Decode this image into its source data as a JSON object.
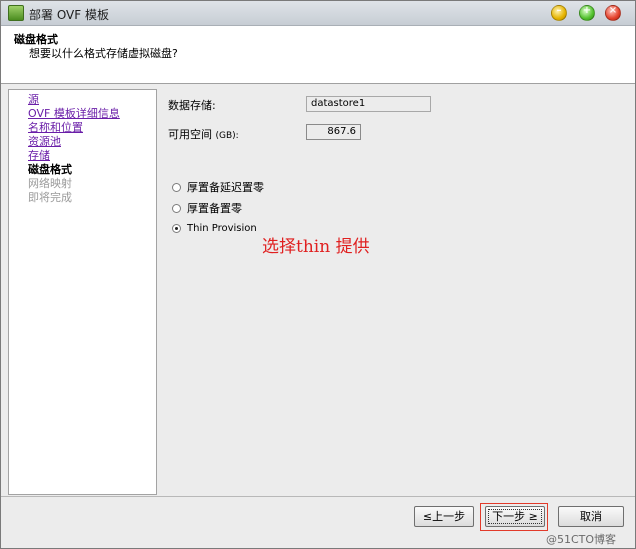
{
  "window": {
    "title": "部署 OVF 模板"
  },
  "header": {
    "title": "磁盘格式",
    "subtitle": "想要以什么格式存储虚拟磁盘?"
  },
  "nav": {
    "items": [
      {
        "label": "源",
        "state": "link"
      },
      {
        "label": "OVF 模板详细信息",
        "state": "link"
      },
      {
        "label": "名称和位置",
        "state": "link"
      },
      {
        "label": "资源池",
        "state": "link"
      },
      {
        "label": "存储",
        "state": "link"
      },
      {
        "label": "磁盘格式",
        "state": "current"
      },
      {
        "label": "网络映射",
        "state": "disabled"
      },
      {
        "label": "即将完成",
        "state": "disabled"
      }
    ]
  },
  "content": {
    "datastore_label": "数据存储:",
    "datastore_value": "datastore1",
    "free_space_label": "可用空间",
    "free_space_unit": "(GB):",
    "free_space_value": "867.6",
    "options": [
      {
        "label": "厚置备延迟置零",
        "checked": false
      },
      {
        "label": "厚置备置零",
        "checked": false
      },
      {
        "label": "Thin Provision",
        "checked": true
      }
    ],
    "annotation": "选择thin 提供"
  },
  "buttons": {
    "back": "≤上一步",
    "next": "下一步 ≥",
    "cancel": "取消"
  },
  "watermark": "@51CTO博客",
  "colors": {
    "link": "#6a1ea8",
    "annotation": "#e02020",
    "highlight_box": "#e23a2a"
  }
}
